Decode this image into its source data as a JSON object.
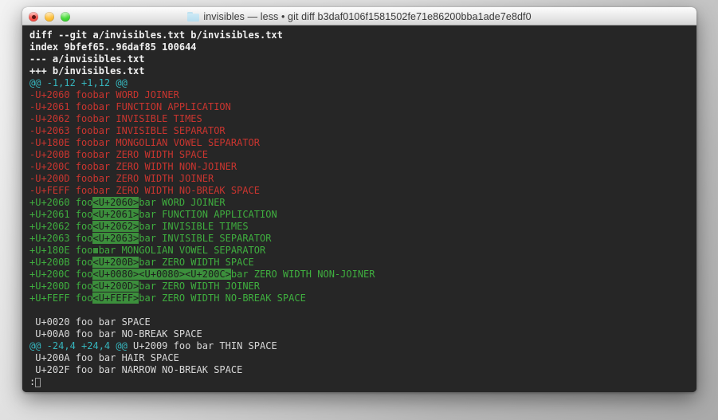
{
  "window": {
    "title": "invisibles — less • git diff b3daf0106f1581502fe71e86200bba1ade7e8df0",
    "folder_icon": "folder-icon",
    "controls": {
      "close": "close-button",
      "minimize": "minimize-button",
      "maximize": "maximize-button"
    }
  },
  "colors": {
    "background": "#262626",
    "text": "#d8d8d8",
    "bold": "#f0f0f0",
    "removed": "#c9352f",
    "added": "#3fae3f",
    "hunk": "#36b5bd",
    "highlight_bg": "#3c8f3c",
    "highlight_fg": "#1d1d1d"
  },
  "terminal": {
    "program": "less",
    "prompt": ":",
    "lines": [
      {
        "type": "bold",
        "text": "diff --git a/invisibles.txt b/invisibles.txt"
      },
      {
        "type": "bold",
        "text": "index 9bfef65..96daf85 100644"
      },
      {
        "type": "bold",
        "text": "--- a/invisibles.txt"
      },
      {
        "type": "bold",
        "text": "+++ b/invisibles.txt"
      },
      {
        "type": "hunk",
        "text": "@@ -1,12 +1,12 @@"
      },
      {
        "type": "removed",
        "text": "-U+2060 foobar WORD JOINER"
      },
      {
        "type": "removed",
        "text": "-U+2061 foobar FUNCTION APPLICATION"
      },
      {
        "type": "removed",
        "text": "-U+2062 foobar INVISIBLE TIMES"
      },
      {
        "type": "removed",
        "text": "-U+2063 foobar INVISIBLE SEPARATOR"
      },
      {
        "type": "removed",
        "text": "-U+180E foobar MONGOLIAN VOWEL SEPARATOR"
      },
      {
        "type": "removed",
        "text": "-U+200B foobar ZERO WIDTH SPACE"
      },
      {
        "type": "removed",
        "text": "-U+200C foobar ZERO WIDTH NON-JOINER"
      },
      {
        "type": "removed",
        "text": "-U+200D foobar ZERO WIDTH JOINER"
      },
      {
        "type": "removed",
        "text": "-U+FEFF foobar ZERO WIDTH NO-BREAK SPACE"
      },
      {
        "type": "added",
        "pre": "+U+2060 foo",
        "marks": [
          "<U+2060>"
        ],
        "post": "bar WORD JOINER"
      },
      {
        "type": "added",
        "pre": "+U+2061 foo",
        "marks": [
          "<U+2061>"
        ],
        "post": "bar FUNCTION APPLICATION"
      },
      {
        "type": "added",
        "pre": "+U+2062 foo",
        "marks": [
          "<U+2062>"
        ],
        "post": "bar INVISIBLE TIMES"
      },
      {
        "type": "added",
        "pre": "+U+2063 foo",
        "marks": [
          "<U+2063>"
        ],
        "post": "bar INVISIBLE SEPARATOR"
      },
      {
        "type": "added-box",
        "pre": "+U+180E foo",
        "post": "bar MONGOLIAN VOWEL SEPARATOR"
      },
      {
        "type": "added",
        "pre": "+U+200B foo",
        "marks": [
          "<U+200B>"
        ],
        "post": "bar ZERO WIDTH SPACE"
      },
      {
        "type": "added",
        "pre": "+U+200C foo",
        "marks": [
          "<U+0080>",
          "<U+0080>",
          "<U+200C>"
        ],
        "post": "bar ZERO WIDTH NON-JOINER"
      },
      {
        "type": "added",
        "pre": "+U+200D foo",
        "marks": [
          "<U+200D>"
        ],
        "post": "bar ZERO WIDTH JOINER"
      },
      {
        "type": "added",
        "pre": "+U+FEFF foo",
        "marks": [
          "<U+FEFF>"
        ],
        "post": "bar ZERO WIDTH NO-BREAK SPACE"
      },
      {
        "type": "blank",
        "text": ""
      },
      {
        "type": "context",
        "text": " U+0020 foo bar SPACE"
      },
      {
        "type": "context",
        "text": " U+00A0 foo bar NO-BREAK SPACE"
      },
      {
        "type": "hunk-inline",
        "hunk": "@@ -24,4 +24,4 @@",
        "rest": " U+2009 foo bar THIN SPACE"
      },
      {
        "type": "context",
        "text": " U+200A foo bar HAIR SPACE"
      },
      {
        "type": "context",
        "text": " U+202F foo bar NARROW NO-BREAK SPACE"
      }
    ]
  }
}
